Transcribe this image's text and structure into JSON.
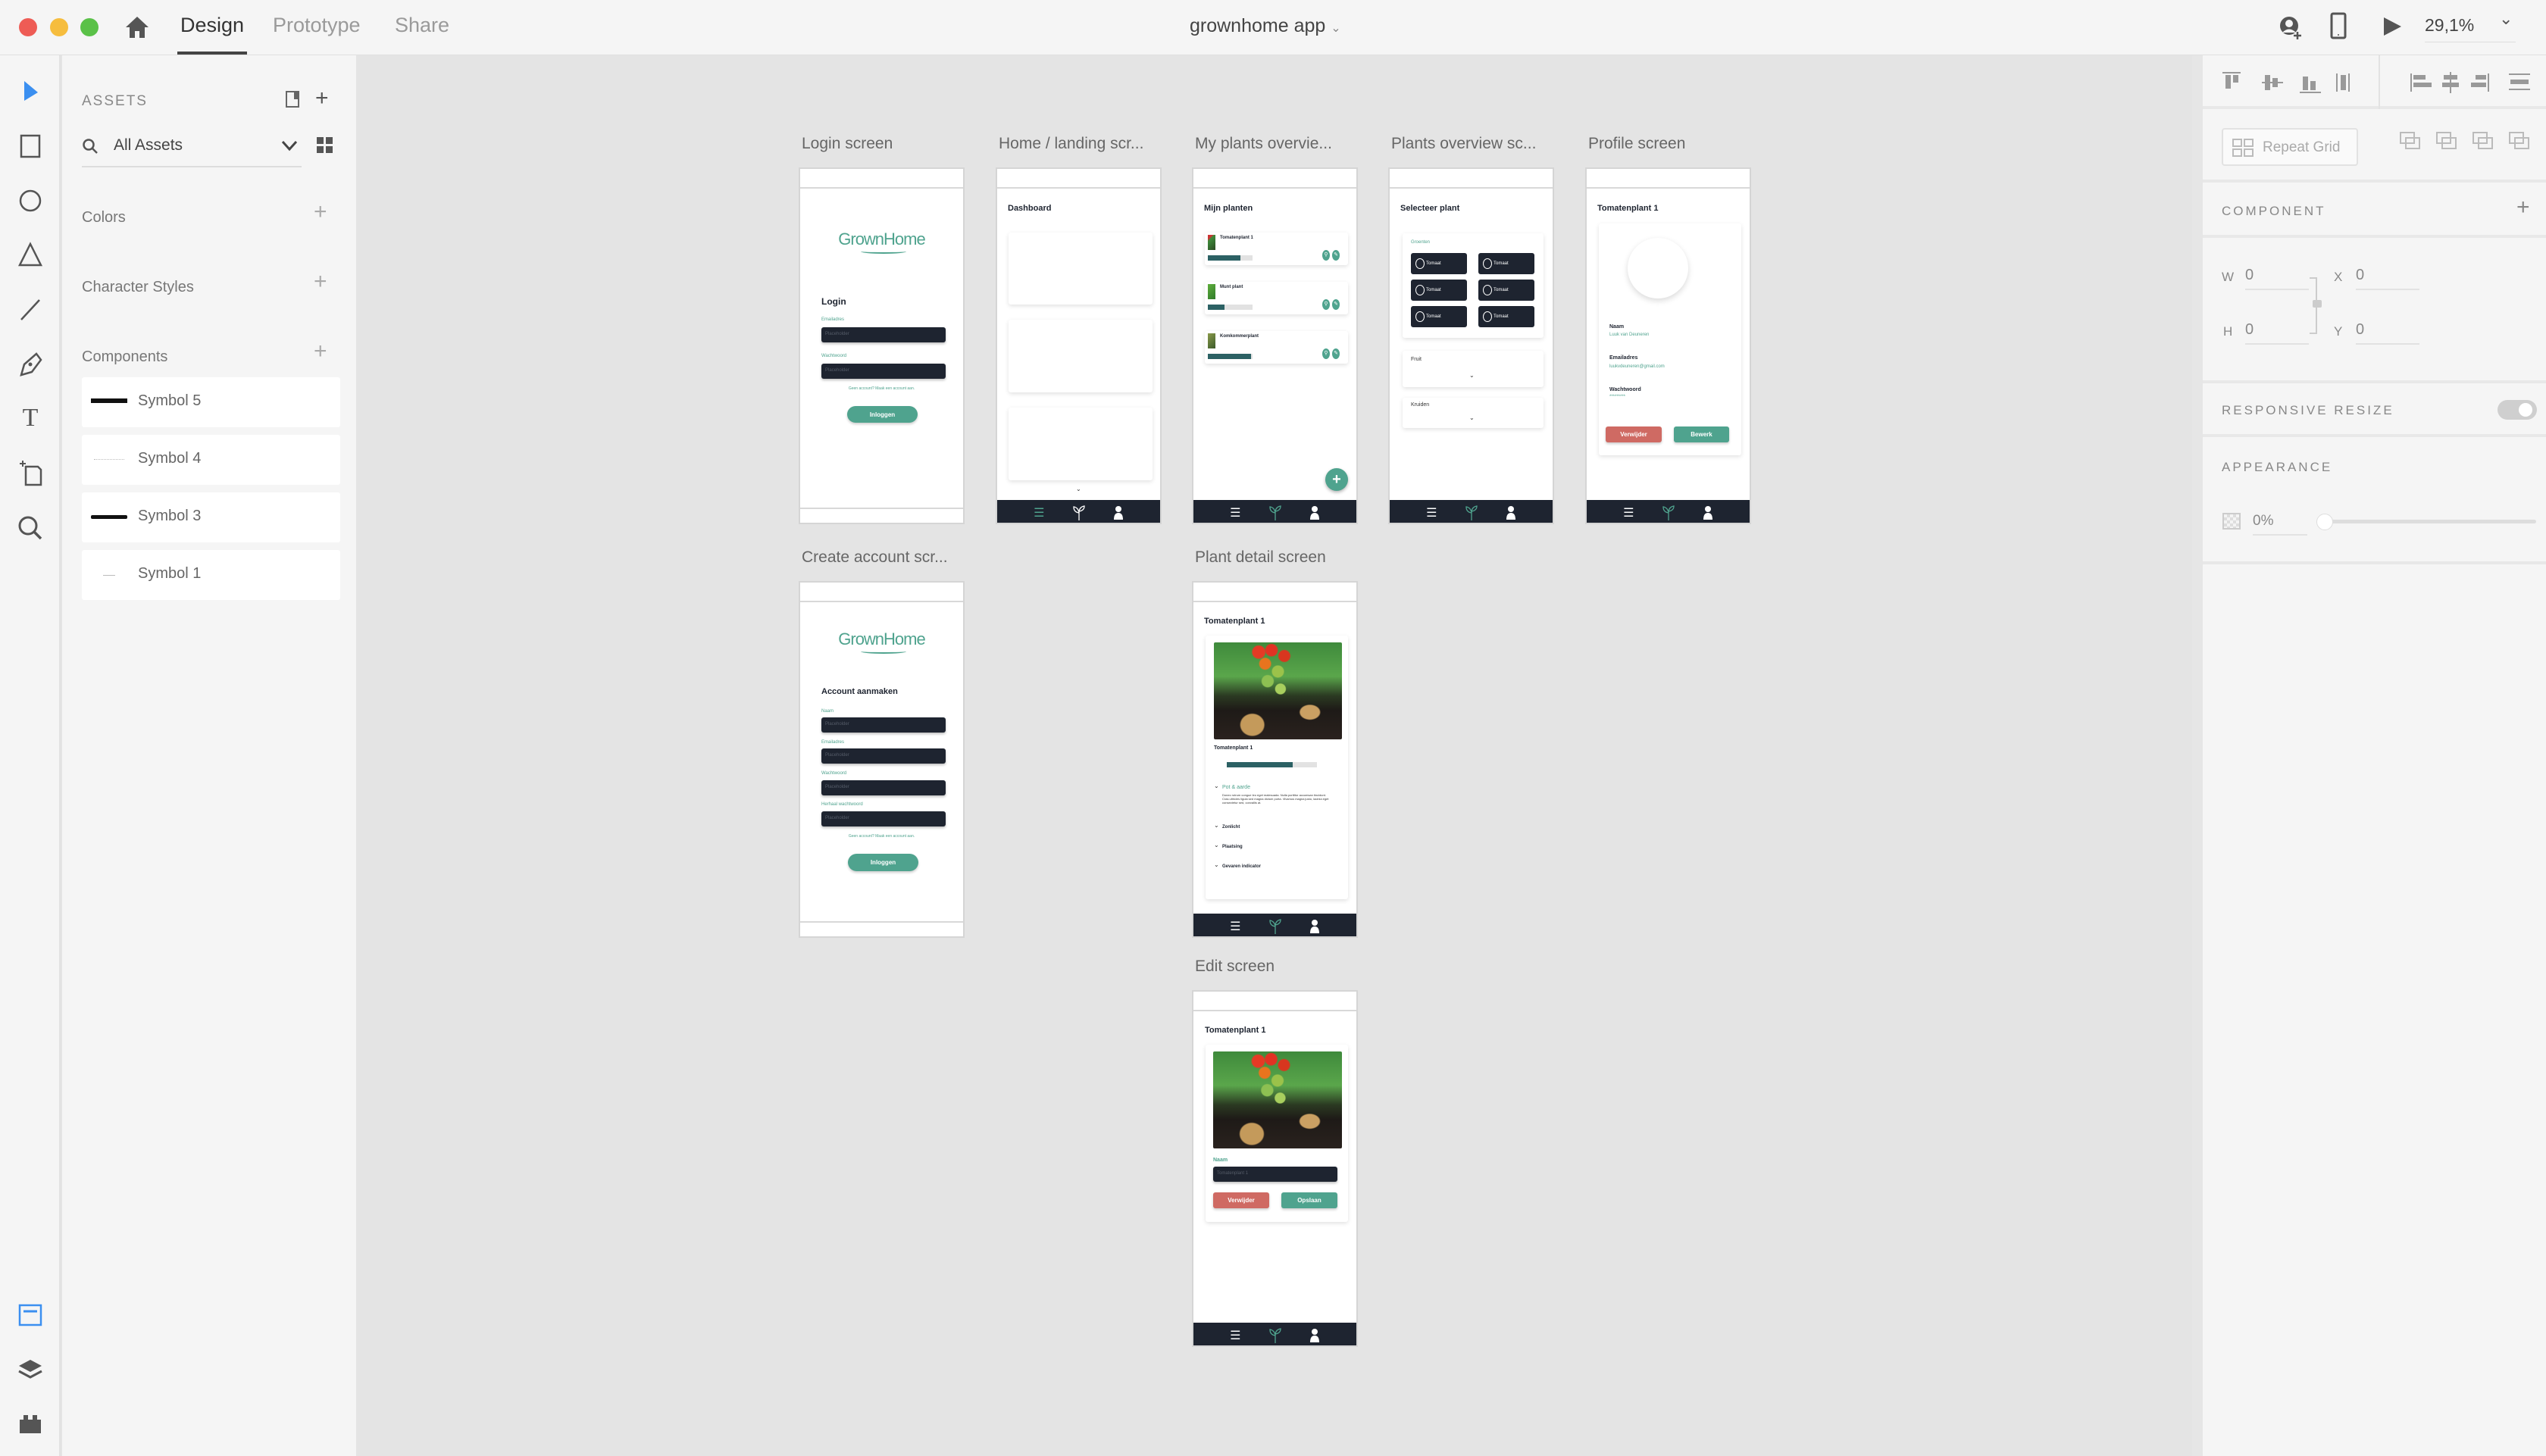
{
  "window": {
    "title": "grownhome app",
    "tabs": [
      "Design",
      "Prototype",
      "Share"
    ],
    "active_tab": "Design",
    "zoom": "29,1%"
  },
  "assets": {
    "title": "ASSETS",
    "filter": "All Assets",
    "colors": "Colors",
    "character_styles": "Character Styles",
    "components": "Components",
    "symbols": [
      "Symbol 5",
      "Symbol 4",
      "Symbol 3",
      "Symbol 1"
    ]
  },
  "properties": {
    "repeat_grid": "Repeat Grid",
    "component": "COMPONENT",
    "w_label": "W",
    "w": "0",
    "h_label": "H",
    "h": "0",
    "x_label": "X",
    "x": "0",
    "y_label": "Y",
    "y": "0",
    "responsive_resize": "RESPONSIVE RESIZE",
    "responsive_resize_on": false,
    "appearance": "APPEARANCE",
    "opacity": "0%",
    "opacity_value": 0
  },
  "colors": {
    "brand": "#4fa38e",
    "dark": "#1e2430",
    "danger": "#cf6a63",
    "progress": "#2c6164",
    "canvas": "#e4e4e4"
  },
  "artboards": {
    "login": {
      "label": "Login screen",
      "logo": "GrownHome",
      "heading": "Login",
      "email_label": "Emailadres",
      "password_label": "Wachtwoord",
      "placeholder": "Placeholder",
      "link": "Geen account? Maak een account aan.",
      "button": "Inloggen"
    },
    "home": {
      "label": "Home / landing scr...",
      "title": "Dashboard"
    },
    "my_plants": {
      "label": "My plants overvie...",
      "title": "Mijn planten",
      "items": [
        {
          "name": "Tomatenplant 1",
          "progress": 0.73
        },
        {
          "name": "Munt plant",
          "progress": 0.38
        },
        {
          "name": "Komkommerplant",
          "progress": 0.96
        }
      ]
    },
    "plants_overview": {
      "label": "Plants overview sc...",
      "title": "Selecteer plant",
      "category": "Groenten",
      "tiles": [
        "Tomaat",
        "Tomaat",
        "Tomaat",
        "Tomaat",
        "Tomaat",
        "Tomaat"
      ],
      "fruit": "Fruit",
      "herbs": "Kruiden"
    },
    "profile": {
      "label": "Profile screen",
      "title": "Tomatenplant 1",
      "name_label": "Naam",
      "name": "Luuk van Deuneren",
      "email_label": "Emailadres",
      "email": "luukvdeuneren@gmail.com",
      "password_label": "Wachtwoord",
      "password": "*********",
      "delete": "Verwijder",
      "edit": "Bewerk"
    },
    "create_account": {
      "label": "Create account scr...",
      "logo": "GrownHome",
      "heading": "Account aanmaken",
      "fields": [
        "Naam",
        "Emailadres",
        "Wachtwoord",
        "Herhaal wachtwoord"
      ],
      "placeholder": "Placeholder",
      "link": "Geen account? Maak een account aan.",
      "button": "Inloggen"
    },
    "plant_detail": {
      "label": "Plant detail screen",
      "title": "Tomatenplant 1",
      "subtitle": "Tomatenplant 1",
      "progress": 0.73,
      "sections": [
        {
          "title": "Pot & aarde",
          "body": "Donec rutrum congue leo eget malesuada. Nulla porttitor accumsan tincidunt. Cras ultricies ligula sed magna dictum porta. Vivamus magna justo, lacinia eget consectetur sed, convallis at."
        },
        {
          "title": "Zonlicht"
        },
        {
          "title": "Plaatsing"
        },
        {
          "title": "Gevaren indicator"
        }
      ]
    },
    "edit": {
      "label": "Edit screen",
      "title": "Tomatenplant 1",
      "name_label": "Naam",
      "name_value": "Tomatenplant 1",
      "delete": "Verwijder",
      "save": "Opslaan"
    }
  }
}
